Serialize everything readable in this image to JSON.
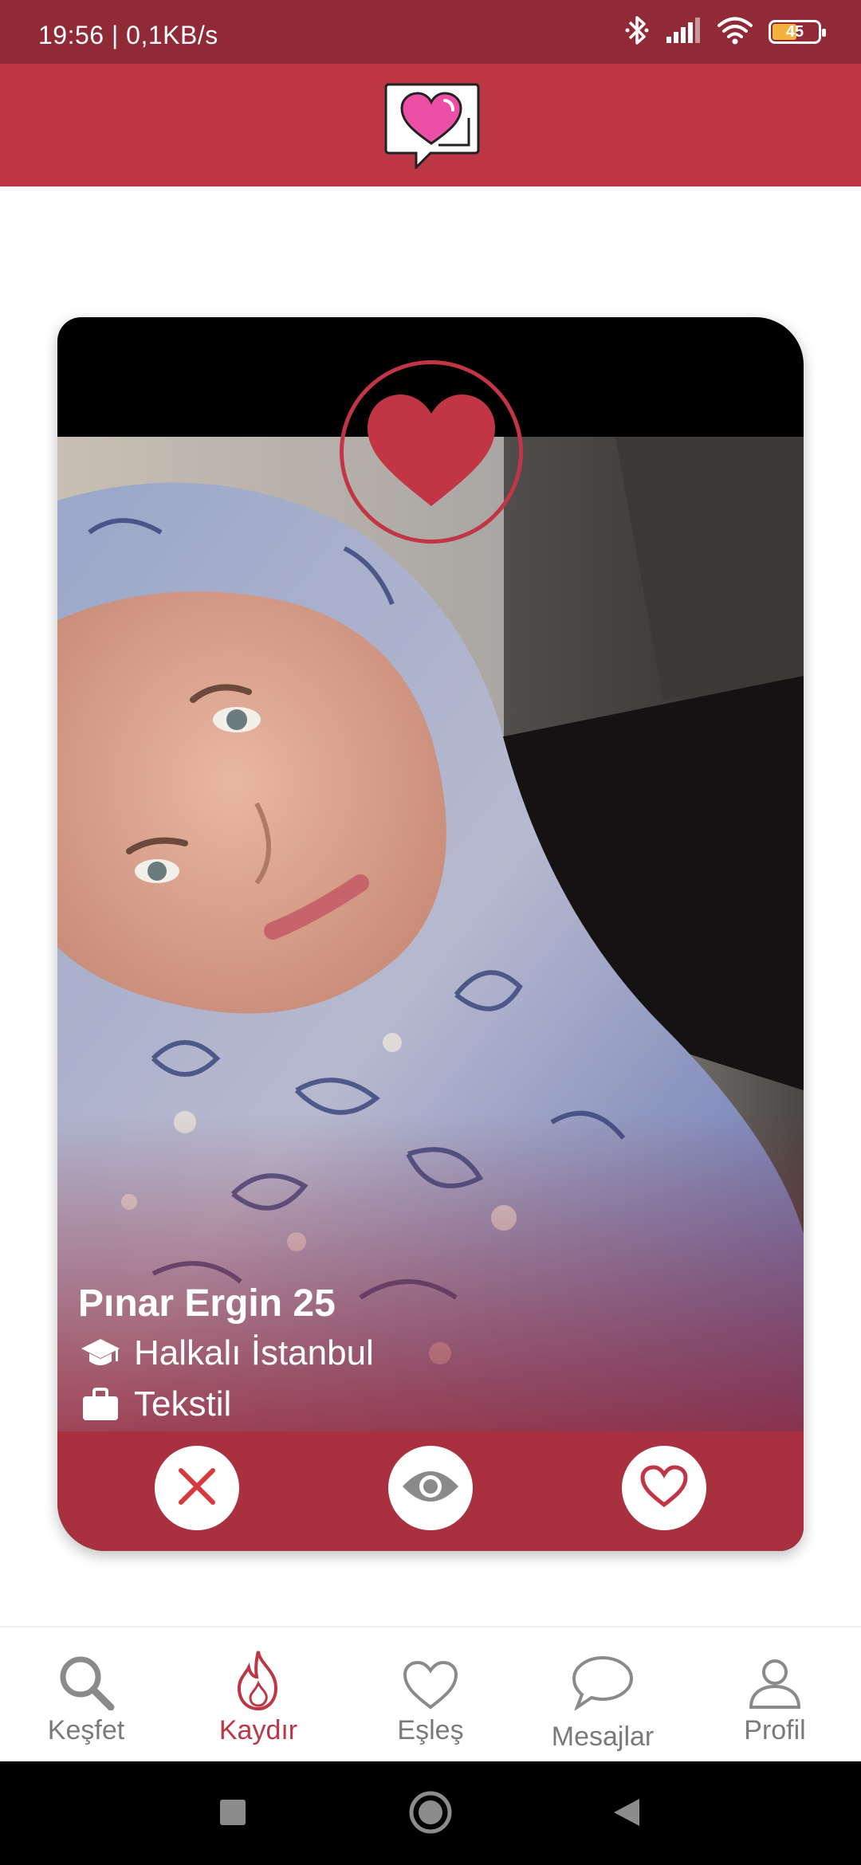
{
  "status_bar": {
    "time_speed": "19:56 | 0,1KB/s",
    "battery": "45"
  },
  "card": {
    "name_age": "Pınar Ergin 25",
    "education": "Halkalı İstanbul",
    "job": "Tekstil"
  },
  "nav": {
    "items": [
      {
        "label": "Keşfet"
      },
      {
        "label": "Kaydır"
      },
      {
        "label": "Eşleş"
      },
      {
        "label": "Mesajlar"
      },
      {
        "label": "Profil"
      }
    ],
    "active": "Kaydır"
  },
  "colors": {
    "header": "#bd3646",
    "status_bar": "#8f2a36",
    "accent": "#bd3646",
    "card_bar": "#a8303f"
  },
  "icons": {
    "status": [
      "bluetooth-icon",
      "signal-icon",
      "wifi-icon",
      "battery-icon"
    ],
    "actions": [
      "close-icon",
      "eye-icon",
      "heart-outline-icon"
    ],
    "nav": [
      "search-icon",
      "flame-icon",
      "heart-outline-icon",
      "chat-bubble-icon",
      "person-icon"
    ]
  }
}
